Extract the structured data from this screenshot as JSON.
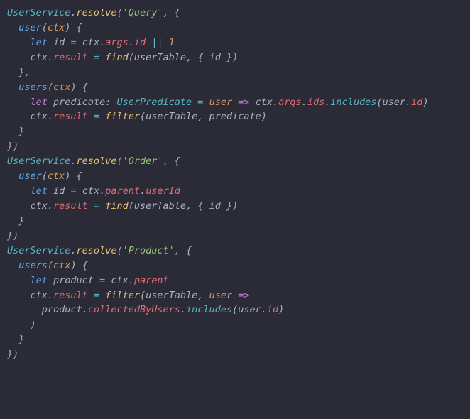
{
  "code": {
    "lines": [
      [
        [
          "type",
          "UserService"
        ],
        [
          "punc",
          "."
        ],
        [
          "call",
          "resolve"
        ],
        [
          "punc",
          "("
        ],
        [
          "str",
          "'Query'"
        ],
        [
          "punc",
          ", {"
        ]
      ],
      [
        [
          "punc",
          "  "
        ],
        [
          "fn",
          "user"
        ],
        [
          "punc",
          "("
        ],
        [
          "param",
          "ctx"
        ],
        [
          "punc",
          ") {"
        ]
      ],
      [
        [
          "punc",
          "    "
        ],
        [
          "kw-let",
          "let"
        ],
        [
          "punc",
          " "
        ],
        [
          "ident",
          "id"
        ],
        [
          "punc",
          " "
        ],
        [
          "op",
          "="
        ],
        [
          "punc",
          " "
        ],
        [
          "ident",
          "ctx"
        ],
        [
          "punc",
          "."
        ],
        [
          "prop",
          "args"
        ],
        [
          "punc",
          "."
        ],
        [
          "prop",
          "id"
        ],
        [
          "punc",
          " "
        ],
        [
          "op",
          "||"
        ],
        [
          "punc",
          " "
        ],
        [
          "num",
          "1"
        ]
      ],
      [
        [
          "punc",
          "    "
        ],
        [
          "ident",
          "ctx"
        ],
        [
          "punc",
          "."
        ],
        [
          "prop",
          "result"
        ],
        [
          "punc",
          " "
        ],
        [
          "op",
          "="
        ],
        [
          "punc",
          " "
        ],
        [
          "call",
          "find"
        ],
        [
          "punc",
          "("
        ],
        [
          "ident",
          "userTable"
        ],
        [
          "punc",
          ", { "
        ],
        [
          "ident",
          "id"
        ],
        [
          "punc",
          " })"
        ]
      ],
      [
        [
          "punc",
          "  },"
        ]
      ],
      [
        [
          "punc",
          "  "
        ],
        [
          "fn",
          "users"
        ],
        [
          "punc",
          "("
        ],
        [
          "param",
          "ctx"
        ],
        [
          "punc",
          ") {"
        ]
      ],
      [
        [
          "punc",
          "    "
        ],
        [
          "kw-decl",
          "let"
        ],
        [
          "punc",
          " "
        ],
        [
          "ident",
          "predicate"
        ],
        [
          "punc",
          ": "
        ],
        [
          "type",
          "UserPredicate"
        ],
        [
          "punc",
          " "
        ],
        [
          "op",
          "="
        ],
        [
          "punc",
          " "
        ],
        [
          "param",
          "user"
        ],
        [
          "punc",
          " "
        ],
        [
          "arrow",
          "=>"
        ],
        [
          "punc",
          " "
        ],
        [
          "ident",
          "ctx"
        ],
        [
          "punc",
          "."
        ],
        [
          "prop",
          "args"
        ],
        [
          "punc",
          "."
        ],
        [
          "prop",
          "ids"
        ],
        [
          "punc",
          "."
        ],
        [
          "method",
          "includes"
        ],
        [
          "punc",
          "("
        ],
        [
          "ident",
          "user"
        ],
        [
          "punc",
          "."
        ],
        [
          "prop",
          "id"
        ],
        [
          "punc",
          ")"
        ]
      ],
      [
        [
          "punc",
          "    "
        ],
        [
          "ident",
          "ctx"
        ],
        [
          "punc",
          "."
        ],
        [
          "prop",
          "result"
        ],
        [
          "punc",
          " "
        ],
        [
          "op",
          "="
        ],
        [
          "punc",
          " "
        ],
        [
          "call",
          "filter"
        ],
        [
          "punc",
          "("
        ],
        [
          "ident",
          "userTable"
        ],
        [
          "punc",
          ", "
        ],
        [
          "ident",
          "predicate"
        ],
        [
          "punc",
          ")"
        ]
      ],
      [
        [
          "punc",
          "  }"
        ]
      ],
      [
        [
          "punc",
          "})"
        ]
      ],
      [
        [
          "punc",
          ""
        ]
      ],
      [
        [
          "type",
          "UserService"
        ],
        [
          "punc",
          "."
        ],
        [
          "call",
          "resolve"
        ],
        [
          "punc",
          "("
        ],
        [
          "str",
          "'Order'"
        ],
        [
          "punc",
          ", {"
        ]
      ],
      [
        [
          "punc",
          "  "
        ],
        [
          "fn",
          "user"
        ],
        [
          "punc",
          "("
        ],
        [
          "param",
          "ctx"
        ],
        [
          "punc",
          ") {"
        ]
      ],
      [
        [
          "punc",
          "    "
        ],
        [
          "kw-let",
          "let"
        ],
        [
          "punc",
          " "
        ],
        [
          "ident",
          "id"
        ],
        [
          "punc",
          " "
        ],
        [
          "op",
          "="
        ],
        [
          "punc",
          " "
        ],
        [
          "ident",
          "ctx"
        ],
        [
          "punc",
          "."
        ],
        [
          "prop",
          "parent"
        ],
        [
          "punc",
          "."
        ],
        [
          "prop",
          "userId"
        ]
      ],
      [
        [
          "punc",
          "    "
        ],
        [
          "ident",
          "ctx"
        ],
        [
          "punc",
          "."
        ],
        [
          "prop",
          "result"
        ],
        [
          "punc",
          " "
        ],
        [
          "op",
          "="
        ],
        [
          "punc",
          " "
        ],
        [
          "call",
          "find"
        ],
        [
          "punc",
          "("
        ],
        [
          "ident",
          "userTable"
        ],
        [
          "punc",
          ", { "
        ],
        [
          "ident",
          "id"
        ],
        [
          "punc",
          " })"
        ]
      ],
      [
        [
          "punc",
          "  }"
        ]
      ],
      [
        [
          "punc",
          "})"
        ]
      ],
      [
        [
          "punc",
          ""
        ]
      ],
      [
        [
          "type",
          "UserService"
        ],
        [
          "punc",
          "."
        ],
        [
          "call",
          "resolve"
        ],
        [
          "punc",
          "("
        ],
        [
          "str",
          "'Product'"
        ],
        [
          "punc",
          ", {"
        ]
      ],
      [
        [
          "punc",
          "  "
        ],
        [
          "fn",
          "users"
        ],
        [
          "punc",
          "("
        ],
        [
          "param",
          "ctx"
        ],
        [
          "punc",
          ") {"
        ]
      ],
      [
        [
          "punc",
          "    "
        ],
        [
          "kw-let",
          "let"
        ],
        [
          "punc",
          " "
        ],
        [
          "ident",
          "product"
        ],
        [
          "punc",
          " "
        ],
        [
          "op",
          "="
        ],
        [
          "punc",
          " "
        ],
        [
          "ident",
          "ctx"
        ],
        [
          "punc",
          "."
        ],
        [
          "prop",
          "parent"
        ]
      ],
      [
        [
          "punc",
          "    "
        ],
        [
          "ident",
          "ctx"
        ],
        [
          "punc",
          "."
        ],
        [
          "prop",
          "result"
        ],
        [
          "punc",
          " "
        ],
        [
          "op",
          "="
        ],
        [
          "punc",
          " "
        ],
        [
          "call",
          "filter"
        ],
        [
          "punc",
          "("
        ],
        [
          "ident",
          "userTable"
        ],
        [
          "punc",
          ", "
        ],
        [
          "param",
          "user"
        ],
        [
          "punc",
          " "
        ],
        [
          "arrow",
          "=>"
        ]
      ],
      [
        [
          "punc",
          "      "
        ],
        [
          "ident",
          "product"
        ],
        [
          "punc",
          "."
        ],
        [
          "prop",
          "collectedByUsers"
        ],
        [
          "punc",
          "."
        ],
        [
          "method",
          "includes"
        ],
        [
          "punc",
          "("
        ],
        [
          "ident",
          "user"
        ],
        [
          "punc",
          "."
        ],
        [
          "prop",
          "id"
        ],
        [
          "punc",
          ")"
        ]
      ],
      [
        [
          "punc",
          "    )"
        ]
      ],
      [
        [
          "punc",
          "  }"
        ]
      ],
      [
        [
          "punc",
          "})"
        ]
      ]
    ]
  }
}
